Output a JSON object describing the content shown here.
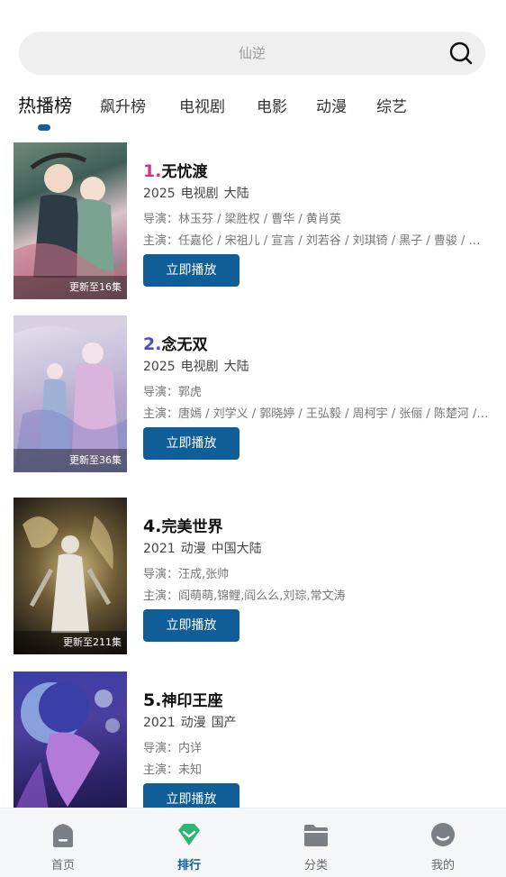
{
  "search": {
    "placeholder": "仙逆"
  },
  "tabs": [
    "热播榜",
    "飙升榜",
    "电视剧",
    "电影",
    "动漫",
    "综艺"
  ],
  "items": [
    {
      "rank": "1.",
      "rank_color": "#d63384",
      "title": "无忧渡",
      "year": "2025",
      "type": "电视剧",
      "region": "大陆",
      "director": "导演：林玉芬 / 梁胜权 / 曹华 / 黄肖英",
      "cast": "主演：任嘉伦 / 宋祖儿 / 宣言 / 刘若谷 / 刘琪锜 / 黑子 / 曹骏 / 苗驰 / 张可盈",
      "episode": "更新至16集",
      "play_label": "立即播放"
    },
    {
      "rank": "2.",
      "rank_color": "#4a4acb",
      "title": "念无双",
      "year": "2025",
      "type": "电视剧",
      "region": "大陆",
      "director": "导演：郭虎",
      "cast": "主演：唐嫣 / 刘学义 / 郭晓婷 / 王弘毅 / 周柯宇 / 张俪 / 陈楚河 / 李泽锋",
      "episode": "更新至36集",
      "play_label": "立即播放"
    },
    {
      "rank": "4.",
      "rank_color": "#111111",
      "title": "完美世界",
      "year": "2021",
      "type": "动漫",
      "region": "中国大陆",
      "director": "导演：汪成,张帅",
      "cast": "主演：阎萌萌,锦鲤,阎么么,刘琮,常文涛",
      "episode": "更新至211集",
      "play_label": "立即播放"
    },
    {
      "rank": "5.",
      "rank_color": "#111111",
      "title": "神印王座",
      "year": "2021",
      "type": "动漫",
      "region": "国产",
      "director": "导演：内详",
      "cast": "主演：未知",
      "episode": "",
      "play_label": "立即播放"
    }
  ],
  "nav": {
    "home": "首页",
    "rank": "排行",
    "category": "分类",
    "mine": "我的"
  },
  "colors": {
    "accent": "#0f5e98",
    "nav_active": "#2bb673"
  }
}
